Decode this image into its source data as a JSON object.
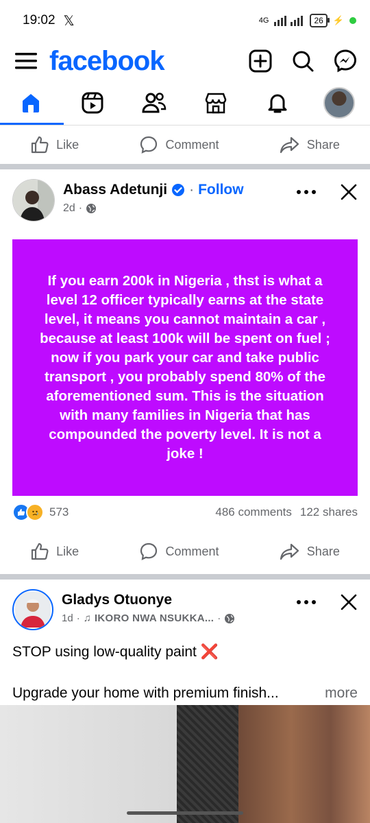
{
  "status": {
    "time": "19:02",
    "x_logo": "𝕏",
    "network": "4G",
    "battery": "26"
  },
  "header": {
    "logo": "facebook"
  },
  "actions": {
    "like": "Like",
    "comment": "Comment",
    "share": "Share"
  },
  "post1": {
    "author": "Abass Adetunji",
    "follow": "Follow",
    "time": "2d",
    "separator": "·",
    "text": "If you earn 200k in Nigeria , thst is what a level 12 officer typically earns at the state level, it means you cannot maintain a car , because at least 100k will be spent on fuel ; now if you park your car and take public transport , you probably spend 80% of the aforementioned sum. This is the situation with many families in Nigeria that has compounded the poverty level.  It is not a joke !",
    "reactions_count": "573",
    "comments": "486 comments",
    "shares": "122 shares"
  },
  "post2": {
    "author": "Gladys Otuonye",
    "time": "1d",
    "separator": "·",
    "music": "IKORO NWA NSUKKA...",
    "text_line1": "STOP using low-quality paint ❌",
    "text_line2": "Upgrade your home with premium finish...",
    "more": "more"
  },
  "colors": {
    "brand": "#0866ff",
    "purple": "#be0bff"
  }
}
